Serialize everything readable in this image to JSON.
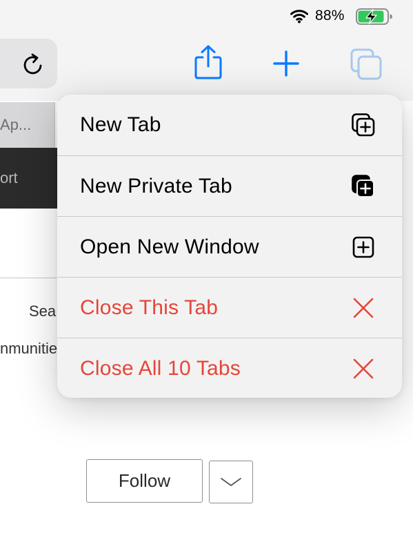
{
  "status_bar": {
    "battery_percent": "88%",
    "icons": [
      "wifi-icon",
      "battery-charging-icon"
    ],
    "battery_level": 0.88,
    "battery_color": "#34c759"
  },
  "toolbar": {
    "icons": [
      "reload-icon",
      "share-icon",
      "plus-icon",
      "tabs-icon"
    ],
    "accent_color": "#0a7aff"
  },
  "page": {
    "tab_label": "Ap...",
    "dark_bar_label": "ort",
    "text_1": "Sea",
    "text_2": "nmunitie",
    "follow_label": "Follow",
    "dropdown_icon": "chevron-down-icon"
  },
  "menu": {
    "items": [
      {
        "label": "New Tab",
        "icon": "new-tab-icon"
      },
      {
        "label": "New Private Tab",
        "icon": "new-private-tab-icon"
      },
      {
        "label": "Open New Window",
        "icon": "new-window-icon"
      },
      {
        "label": "Close This Tab",
        "icon": "close-icon",
        "destructive": true
      },
      {
        "label": "Close All 10 Tabs",
        "icon": "close-icon",
        "destructive": true
      }
    ],
    "destructive_color": "#e5453a"
  }
}
